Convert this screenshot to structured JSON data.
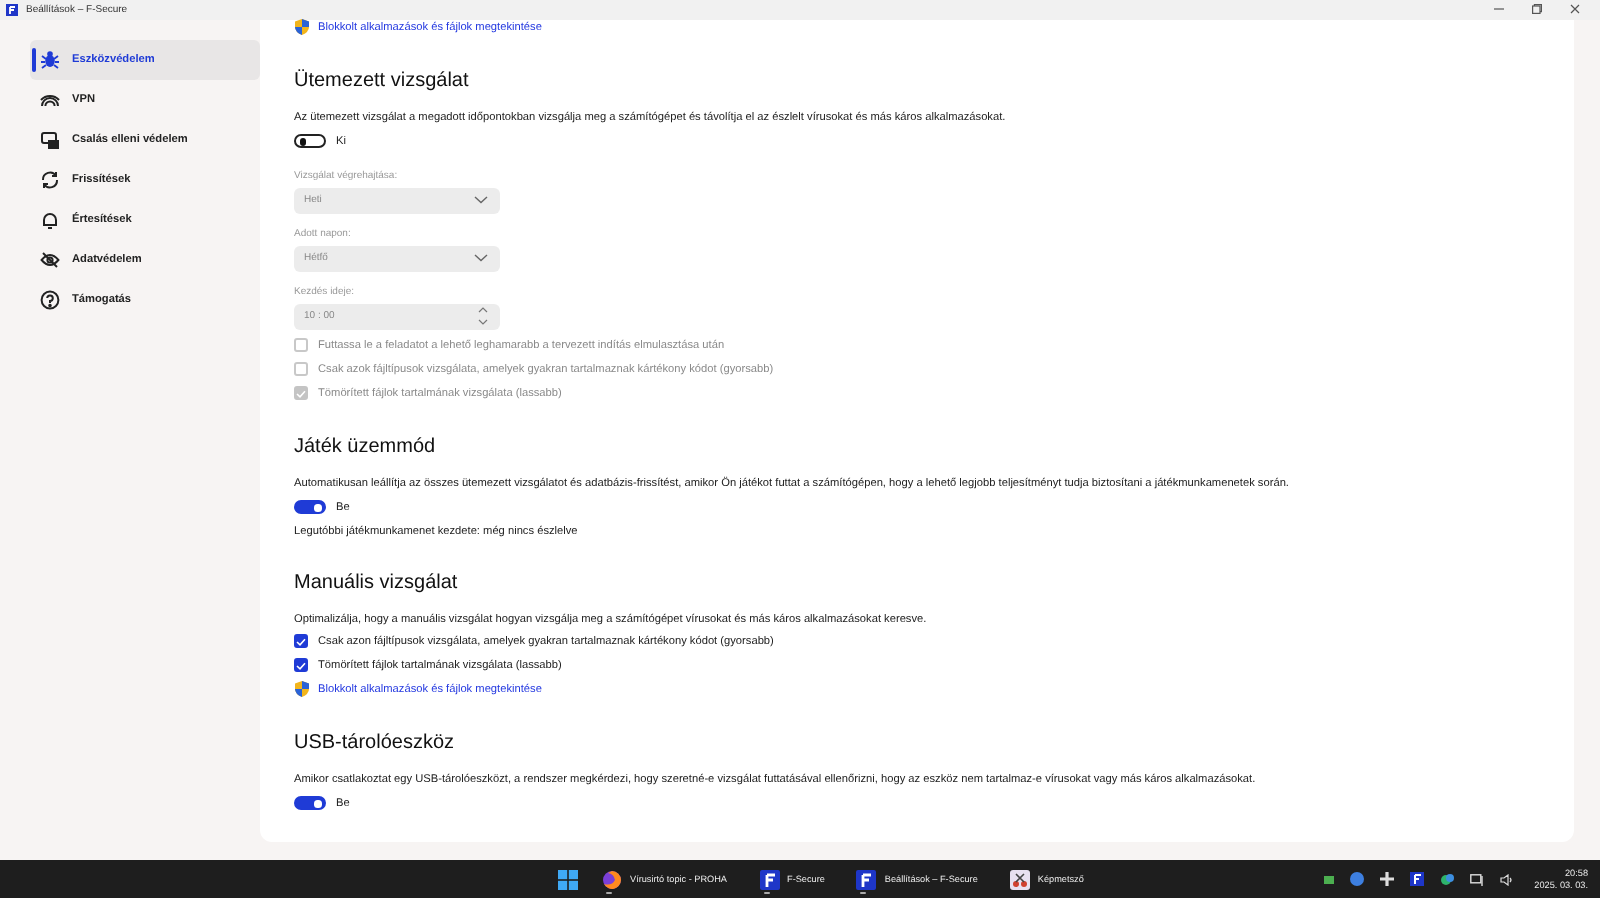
{
  "window": {
    "title": "Beállítások – F-Secure"
  },
  "sidebar": {
    "items": [
      {
        "label": "Eszközvédelem",
        "selected": true
      },
      {
        "label": "VPN",
        "selected": false
      },
      {
        "label": "Csalás elleni védelem",
        "selected": false
      },
      {
        "label": "Frissítések",
        "selected": false
      },
      {
        "label": "Értesítések",
        "selected": false
      },
      {
        "label": "Adatvédelem",
        "selected": false
      },
      {
        "label": "Támogatás",
        "selected": false
      }
    ]
  },
  "top_link": {
    "label": "Blokkolt alkalmazások és fájlok megtekintése"
  },
  "sections": [
    {
      "heading": "Ütemezett vizsgálat",
      "items": [
        {
          "kind": "description",
          "text": "Az ütemezett vizsgálat a megadott időpontokban vizsgálja meg a számítógépet és távolítja el az észlelt vírusokat és más káros alkalmazásokat."
        },
        {
          "kind": "toggle",
          "label": "Ki",
          "on": false
        },
        {
          "kind": "select",
          "label": "Vizsgálat végrehajtása:",
          "value": "Heti",
          "disabled": true
        },
        {
          "kind": "select",
          "label": "Adott napon:",
          "value": "Hétfő",
          "disabled": true
        },
        {
          "kind": "time",
          "label": "Kezdés ideje:",
          "value": "10 : 00",
          "disabled": true
        },
        {
          "kind": "checkbox",
          "label": "Futtassa le a feladatot a lehető leghamarabb a tervezett indítás elmulasztása után",
          "checked": false,
          "disabled": true
        },
        {
          "kind": "checkbox",
          "label": "Csak azok fájltípusok vizsgálata, amelyek gyakran tartalmaznak kártékony kódot (gyorsabb)",
          "checked": false,
          "disabled": true
        },
        {
          "kind": "checkbox",
          "label": "Tömörített fájlok tartalmának vizsgálata (lassabb)",
          "checked": true,
          "disabled": true
        }
      ]
    },
    {
      "heading": "Játék üzemmód",
      "items": [
        {
          "kind": "description",
          "text": "Automatikusan leállítja az összes ütemezett vizsgálatot és adatbázis-frissítést, amikor Ön játékot futtat a számítógépen, hogy a lehető legjobb teljesítményt tudja biztosítani a játékmunkamenetek során."
        },
        {
          "kind": "toggle",
          "label": "Be",
          "on": true
        },
        {
          "kind": "note",
          "text": "Legutóbbi játékmunkamenet kezdete: még nincs észlelve"
        }
      ]
    },
    {
      "heading": "Manuális vizsgálat",
      "items": [
        {
          "kind": "description",
          "text": "Optimalizálja, hogy a manuális vizsgálat hogyan vizsgálja meg a számítógépet vírusokat és más káros alkalmazásokat keresve."
        },
        {
          "kind": "checkbox",
          "label": "Csak azon fájltípusok vizsgálata, amelyek gyakran tartalmaznak kártékony kódot (gyorsabb)",
          "checked": true,
          "disabled": false
        },
        {
          "kind": "checkbox",
          "label": "Tömörített fájlok tartalmának vizsgálata (lassabb)",
          "checked": true,
          "disabled": false
        },
        {
          "kind": "link",
          "label": "Blokkolt alkalmazások és fájlok megtekintése"
        }
      ]
    },
    {
      "heading": "USB-tárolóeszköz",
      "items": [
        {
          "kind": "description",
          "text": "Amikor csatlakoztat egy USB-tárolóeszközt, a rendszer megkérdezi, hogy szeretné-e vizsgálat futtatásával ellenőrizni, hogy az eszköz nem tartalmaz-e vírusokat vagy más káros alkalmazásokat."
        },
        {
          "kind": "toggle",
          "label": "Be",
          "on": true
        }
      ]
    }
  ],
  "taskbar": {
    "apps": [
      {
        "label": "Vírusirtó topic - PROHA",
        "running": true
      },
      {
        "label": "F-Secure",
        "running": true
      },
      {
        "label": "Beállítások – F-Secure",
        "running": true
      },
      {
        "label": "Képmetsző",
        "running": false
      }
    ],
    "clock": {
      "time": "20:58",
      "date": "2025. 03. 03."
    }
  }
}
